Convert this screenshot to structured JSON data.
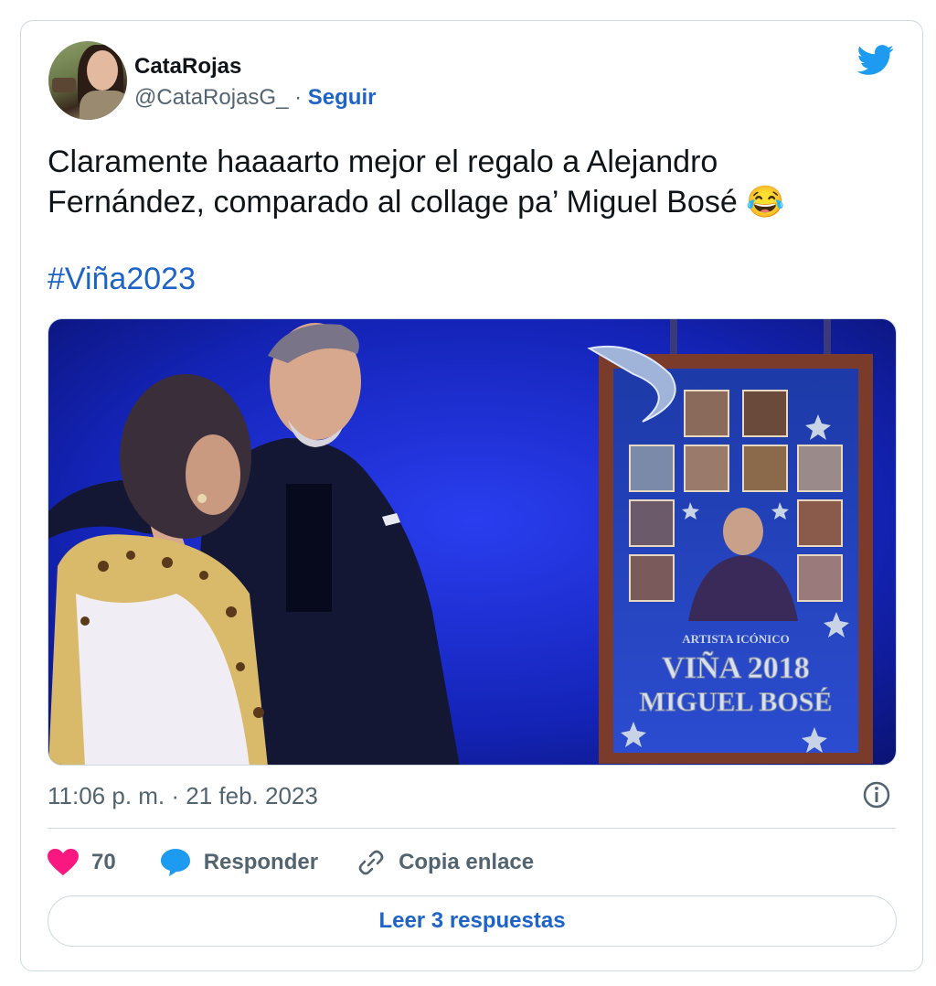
{
  "tweet": {
    "display_name": "CataRojas",
    "handle": "@CataRojasG_",
    "separator": " · ",
    "follow_label": "Seguir",
    "text_line1": "Claramente haaaarto mejor el regalo a Alejandro",
    "text_line2": "Fernández, comparado al collage pa’ Miguel Bosé 😂",
    "hashtag": "#Viña2023",
    "timestamp": "11:06 p. m. · 21 feb. 2023",
    "likes_count": "70",
    "reply_label": "Responder",
    "copy_link_label": "Copia enlace",
    "read_replies_label": "Leer 3 respuestas"
  },
  "media": {
    "poster_line1": "ARTISTA ICÓNICO",
    "poster_line2": "VIÑA 2018",
    "poster_line3": "MIGUEL BOSÉ"
  },
  "icons": {
    "brand": "twitter-bird-icon",
    "info": "info-circle-icon",
    "like": "heart-icon",
    "reply": "speech-bubble-icon",
    "copy": "link-icon"
  },
  "colors": {
    "accent": "#1d63c8",
    "twitter_blue": "#1d9bf0",
    "like_pink": "#f91880",
    "muted_text": "#536471",
    "border": "#cfd9de"
  }
}
